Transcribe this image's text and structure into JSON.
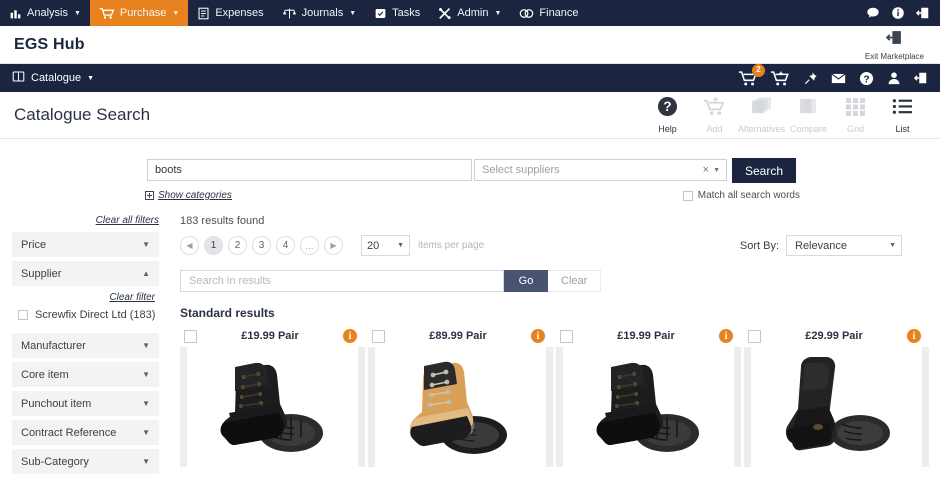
{
  "topnav": {
    "items": [
      {
        "label": "Analysis",
        "icon": "chart-bar-icon",
        "caret": true,
        "active": false
      },
      {
        "label": "Purchase",
        "icon": "shopping-cart-icon",
        "caret": true,
        "active": true
      },
      {
        "label": "Expenses",
        "icon": "receipt-icon",
        "caret": false,
        "active": false
      },
      {
        "label": "Journals",
        "icon": "scales-icon",
        "caret": true,
        "active": false
      },
      {
        "label": "Tasks",
        "icon": "tasks-icon",
        "caret": false,
        "active": false
      },
      {
        "label": "Admin",
        "icon": "tools-icon",
        "caret": true,
        "active": false
      },
      {
        "label": "Finance",
        "icon": "coins-icon",
        "caret": false,
        "active": false
      }
    ],
    "right_icons": [
      "chat-bubble-icon",
      "info-circle-icon",
      "logout-icon"
    ]
  },
  "brandbar": {
    "title": "EGS Hub",
    "exit_label": "Exit Marketplace",
    "exit_icon": "exit-door-icon"
  },
  "catbar": {
    "menu_label": "Catalogue",
    "menu_icon": "book-icon",
    "cart_badge": "2",
    "icons": [
      "cart-badge-icon",
      "cart-add-icon",
      "pin-icon",
      "mail-icon",
      "help-circle-icon",
      "user-icon",
      "logout-icon"
    ]
  },
  "page": {
    "title": "Catalogue Search"
  },
  "toolbar": {
    "items": [
      {
        "label": "Help",
        "icon": "help-circle-icon",
        "enabled": true
      },
      {
        "label": "Add",
        "icon": "cart-add-icon",
        "enabled": false
      },
      {
        "label": "Alternatives",
        "icon": "layers-icon",
        "enabled": false
      },
      {
        "label": "Compare",
        "icon": "compare-icon",
        "enabled": false
      },
      {
        "label": "Grid",
        "icon": "grid-icon",
        "enabled": false
      },
      {
        "label": "List",
        "icon": "list-icon",
        "enabled": true
      }
    ]
  },
  "search": {
    "query_value": "boots",
    "query_placeholder": "",
    "supplier_placeholder": "Select suppliers",
    "supplier_clear": "×",
    "search_button": "Search",
    "show_categories": "Show categories",
    "match_all_label": "Match all search words"
  },
  "sidebar": {
    "clear_all": "Clear all filters",
    "facets": [
      {
        "label": "Price",
        "expanded": false
      },
      {
        "label": "Supplier",
        "expanded": true,
        "clear_filter": "Clear filter",
        "options": [
          {
            "label": "Screwfix Direct Ltd (183)",
            "checked": false
          }
        ]
      },
      {
        "label": "Manufacturer",
        "expanded": false
      },
      {
        "label": "Core item",
        "expanded": false
      },
      {
        "label": "Punchout item",
        "expanded": false
      },
      {
        "label": "Contract Reference",
        "expanded": false
      },
      {
        "label": "Sub-Category",
        "expanded": false
      }
    ]
  },
  "results": {
    "count_text": "183 results found",
    "pagination": {
      "prev": "◀",
      "pages": [
        "1",
        "2",
        "3",
        "4"
      ],
      "current": "1",
      "ellipsis": "…",
      "next": "▶"
    },
    "items_per_page_value": "20",
    "items_per_page_label": "items per page",
    "sort_label": "Sort By:",
    "sort_value": "Relevance",
    "search_in_results_placeholder": "Search in results",
    "go_label": "Go",
    "clear_label": "Clear",
    "standard_heading": "Standard results",
    "cards": [
      {
        "price": "£19.99 Pair",
        "image": "black-safety-boots",
        "colors": {
          "upper": "#1d1d1f",
          "sole": "#2b2b2d",
          "accent": "#6a5c2c"
        }
      },
      {
        "price": "£89.99 Pair",
        "image": "tan-hiker-boots",
        "colors": {
          "upper": "#d9a157",
          "sole": "#1d1d1f",
          "accent": "#2b2b2d"
        }
      },
      {
        "price": "£19.99 Pair",
        "image": "black-safety-boots",
        "colors": {
          "upper": "#1d1d1f",
          "sole": "#2b2b2d",
          "accent": "#6a5c2c"
        }
      },
      {
        "price": "£29.99 Pair",
        "image": "black-rigger-boots",
        "colors": {
          "upper": "#232326",
          "sole": "#2b2b2d",
          "accent": "#6a5c2c"
        }
      }
    ]
  },
  "colors": {
    "navy": "#1b2540",
    "orange": "#e8821e",
    "slate": "#4a5472"
  }
}
